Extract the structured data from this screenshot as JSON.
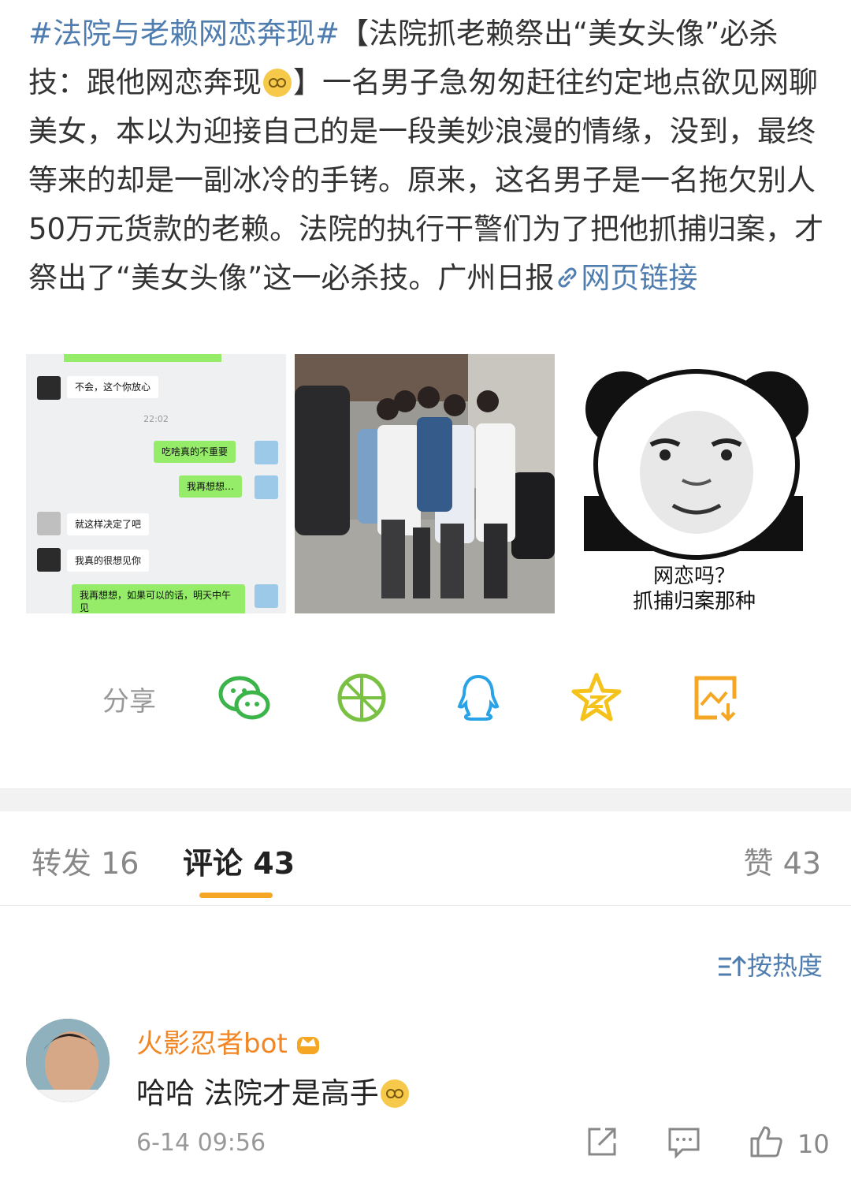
{
  "post": {
    "topic": "#法院与老赖网恋奔现#",
    "text_a": "【法院抓老赖祭出“美女头像”必杀技：跟他网恋奔现",
    "text_b": "】一名男子急匆匆赶往约定地点欲见网聊美女，本以为迎接自己的是一段美妙浪漫的情缘，没到，最终等来的却是一副冰冷的手铐。原来，这名男子是一名拖欠别人50万元货款的老赖。法院的执行干警们为了把他抓捕归案，才祭出了“美女头像”这一必杀技。广州日报",
    "link_label": "网页链接",
    "emoji_name": "tears-face-emoji",
    "link_color": "#507daf"
  },
  "images": {
    "chat": {
      "msg1": "不会，这个你放心",
      "time": "22:02",
      "msg2": "吃啥真的不重要",
      "msg3": "我再想想…",
      "msg4": "就这样决定了吧",
      "msg5": "我真的很想见你",
      "msg6": "我再想想，如果可以的话，明天中午见"
    },
    "meme": {
      "line1": "网恋吗？",
      "line2": "抓捕归案那种"
    }
  },
  "share": {
    "label": "分享",
    "icons": [
      "wechat-icon",
      "moments-icon",
      "qq-icon",
      "qzone-icon",
      "save-image-icon"
    ],
    "colors": {
      "wechat": "#3bb549",
      "moments": "#7ac143",
      "qq": "#2aa3e6",
      "qzone": "#f5c21b",
      "save": "#f5a623"
    }
  },
  "tabs": {
    "repost_label": "转发",
    "repost_count": "16",
    "comment_label": "评论",
    "comment_count": "43",
    "like_label": "赞",
    "like_count": "43",
    "accent": "#f5a623"
  },
  "sort": {
    "label": "按热度"
  },
  "comment": {
    "user": "火影忍者bot",
    "text": "哈哈 法院才是高手",
    "time": "6-14 09:56",
    "likes": "10",
    "name_color": "#f28624"
  }
}
